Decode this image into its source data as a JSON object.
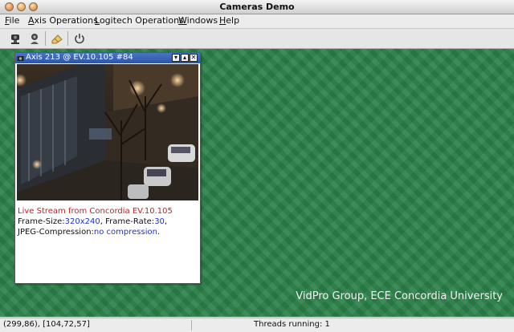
{
  "window": {
    "title": "Cameras Demo"
  },
  "menu": [
    {
      "label": "File",
      "mnemonic": "F",
      "rest": "ile"
    },
    {
      "label": "Axis Operations",
      "mnemonic": "A",
      "rest": "xis Operations"
    },
    {
      "label": "Logitech Operations",
      "mnemonic": "L",
      "rest": "ogitech Operations"
    },
    {
      "label": "Windows",
      "mnemonic": "W",
      "rest": "indows"
    },
    {
      "label": "Help",
      "mnemonic": "H",
      "rest": "elp"
    }
  ],
  "toolbar": {
    "icons": [
      "camera-axis-icon",
      "camera-logitech-icon",
      "eraser-icon",
      "power-icon"
    ]
  },
  "camera_window": {
    "title": "Axis 213 @ EV.10.105 #84",
    "controls": [
      "▾",
      "▴",
      "✕"
    ],
    "stream_label": "Live Stream from Concordia EV.10.105",
    "frame_size_label": "Frame-Size:",
    "frame_size_value": "320x240",
    "frame_rate_label": ", Frame-Rate:",
    "frame_rate_value": "30",
    "frame_rate_end": ",",
    "jpeg_label": "JPEG-Compression:",
    "jpeg_value": "no compression",
    "jpeg_end": "."
  },
  "workspace": {
    "watermark": "VidPro Group, ECE Concordia University"
  },
  "status": {
    "coords": "(299,86), [104,72,57]",
    "threads": "Threads running: 1"
  },
  "colors": {
    "workspace": "#2a8048",
    "frame_title": "#2d55a6",
    "stream_text": "#d11b1b",
    "value_text": "#2233cc"
  }
}
